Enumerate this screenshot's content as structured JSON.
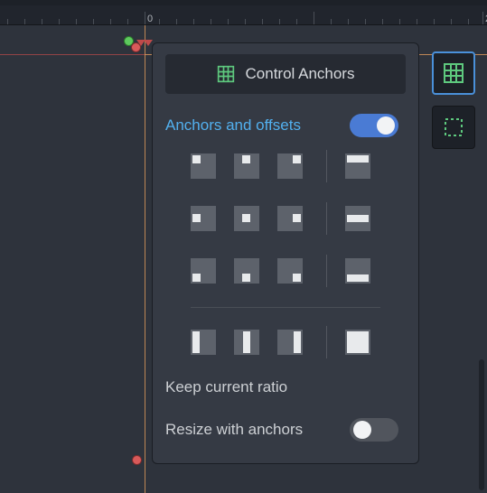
{
  "ruler": {
    "label_0": "0",
    "label_2": "2"
  },
  "panel": {
    "title": "Control Anchors",
    "anchors_offsets_label": "Anchors and offsets",
    "anchors_offsets_on": true,
    "keep_ratio_label": "Keep current ratio",
    "resize_anchors_label": "Resize with anchors",
    "resize_anchors_on": false
  },
  "toolbar": {
    "anchor_tool_active": true
  }
}
